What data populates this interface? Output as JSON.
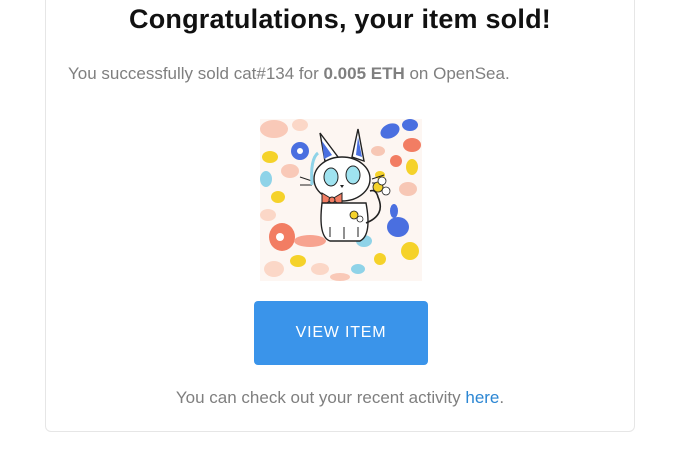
{
  "email": {
    "title": "Congratulations, your item sold!",
    "message": {
      "prefix": "You successfully sold ",
      "item_name": "cat#134",
      "for_text": " for ",
      "price": "0.005 ETH",
      "suffix": " on OpenSea."
    },
    "item_image_alt": "cat#134",
    "button_label": "VIEW ITEM",
    "activity": {
      "prefix": "You can check out your recent activity ",
      "link_text": "here",
      "suffix": "."
    }
  },
  "colors": {
    "button": "#3a94ea",
    "link": "#2b86d3",
    "body_text": "#7f7f7f",
    "title_text": "#111111"
  }
}
